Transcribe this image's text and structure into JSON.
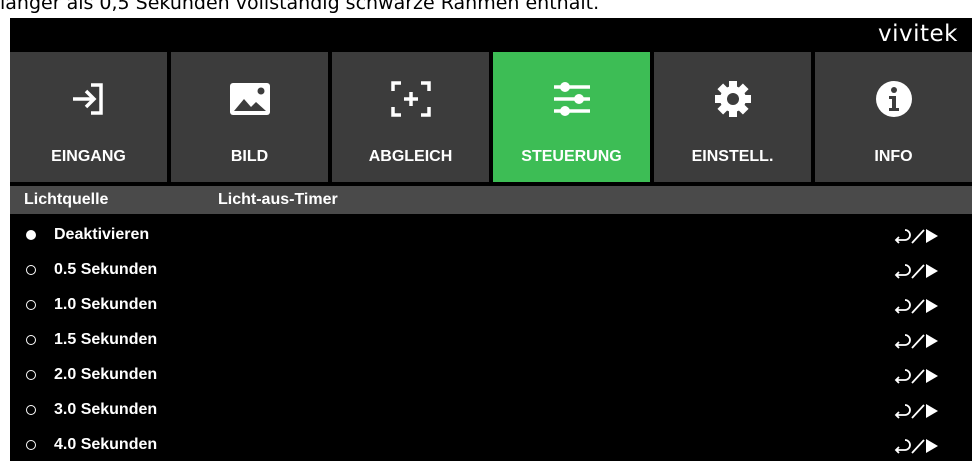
{
  "caption": "länger als 0,5 Sekunden vollständig schwarze Rahmen enthält.",
  "brand": "vivitek",
  "tabs": [
    {
      "label": "EINGANG",
      "icon": "input-icon",
      "active": false
    },
    {
      "label": "BILD",
      "icon": "image-icon",
      "active": false
    },
    {
      "label": "ABGLEICH",
      "icon": "alignment-icon",
      "active": false
    },
    {
      "label": "STEUERUNG",
      "icon": "sliders-icon",
      "active": true
    },
    {
      "label": "EINSTELL.",
      "icon": "gear-icon",
      "active": false
    },
    {
      "label": "INFO",
      "icon": "info-icon",
      "active": false
    }
  ],
  "header": {
    "category": "Lichtquelle",
    "setting": "Licht-aus-Timer"
  },
  "options": [
    {
      "label": "Deaktivieren",
      "selected": true
    },
    {
      "label": "0.5 Sekunden",
      "selected": false
    },
    {
      "label": "1.0 Sekunden",
      "selected": false
    },
    {
      "label": "1.5 Sekunden",
      "selected": false
    },
    {
      "label": "2.0 Sekunden",
      "selected": false
    },
    {
      "label": "3.0 Sekunden",
      "selected": false
    },
    {
      "label": "4.0 Sekunden",
      "selected": false
    }
  ],
  "colors": {
    "active_tab": "#3dbd55",
    "tab_bg": "#3c3c3c",
    "header_bg": "#4a4a4a",
    "osd_bg": "#000000"
  }
}
